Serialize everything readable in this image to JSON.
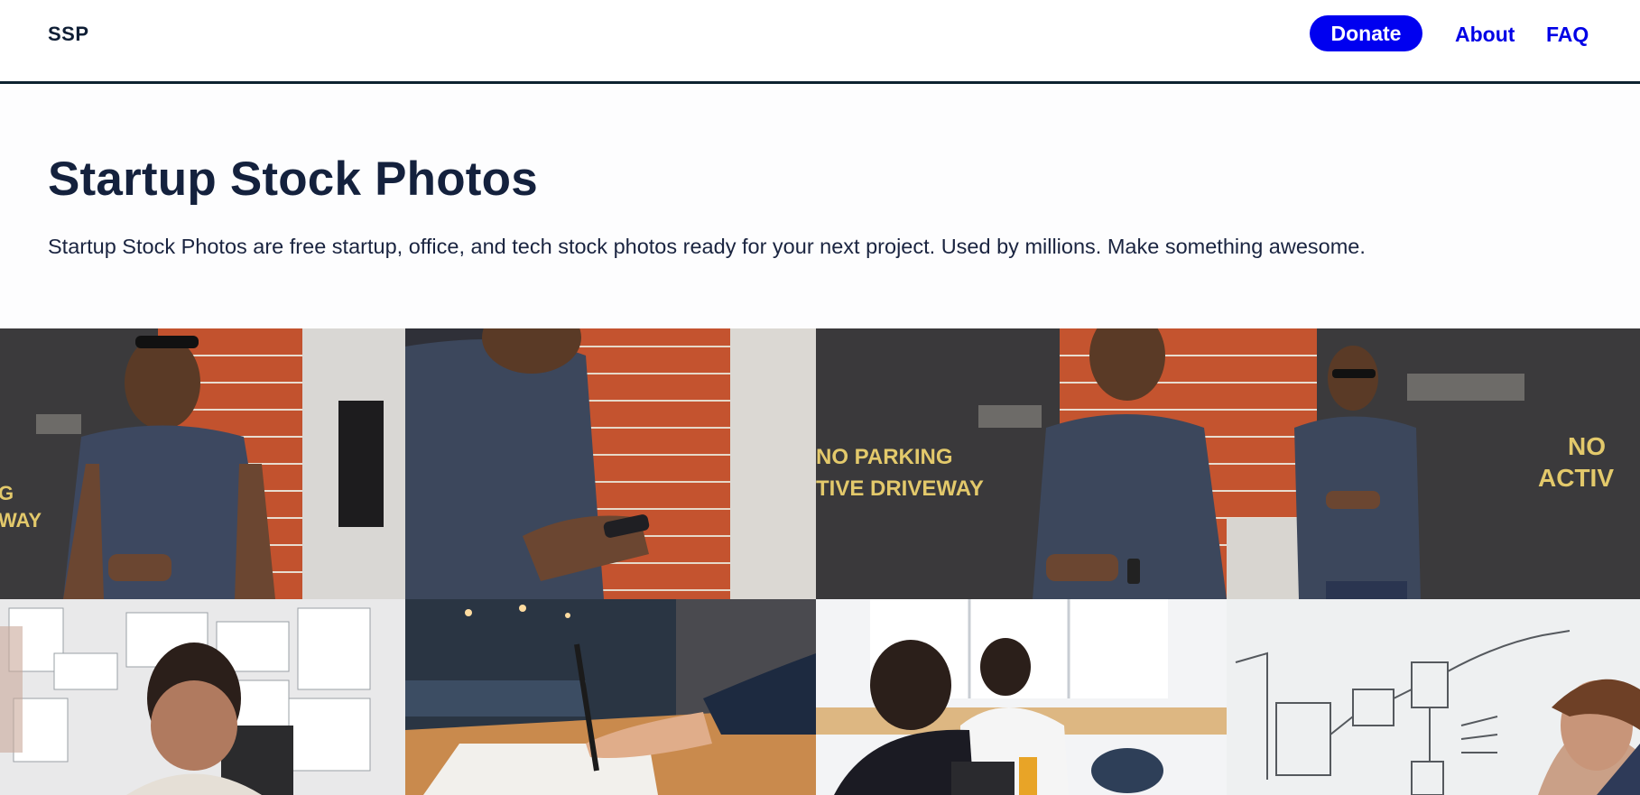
{
  "header": {
    "logo": "SSP",
    "donate_label": "Donate",
    "about_label": "About",
    "faq_label": "FAQ",
    "accent_color": "#0000f0"
  },
  "hero": {
    "title": "Startup Stock Photos",
    "subtitle": "Startup Stock Photos are free startup, office, and tech stock photos ready for your next project. Used by millions. Make something awesome."
  },
  "photos": [
    {
      "name": "man-phone-street-1",
      "sign_text": "G\nWAY"
    },
    {
      "name": "man-phone-closeup"
    },
    {
      "name": "man-phone-no-parking",
      "sign_text": "NO PARKING\nTIVE DRIVEWAY"
    },
    {
      "name": "man-leaning-wall-phone",
      "sign_text": "NO\nACTIV"
    },
    {
      "name": "man-facing-sketch-wall"
    },
    {
      "name": "hand-writing-pen"
    },
    {
      "name": "people-working-table"
    },
    {
      "name": "man-whiteboard-drawing"
    }
  ]
}
